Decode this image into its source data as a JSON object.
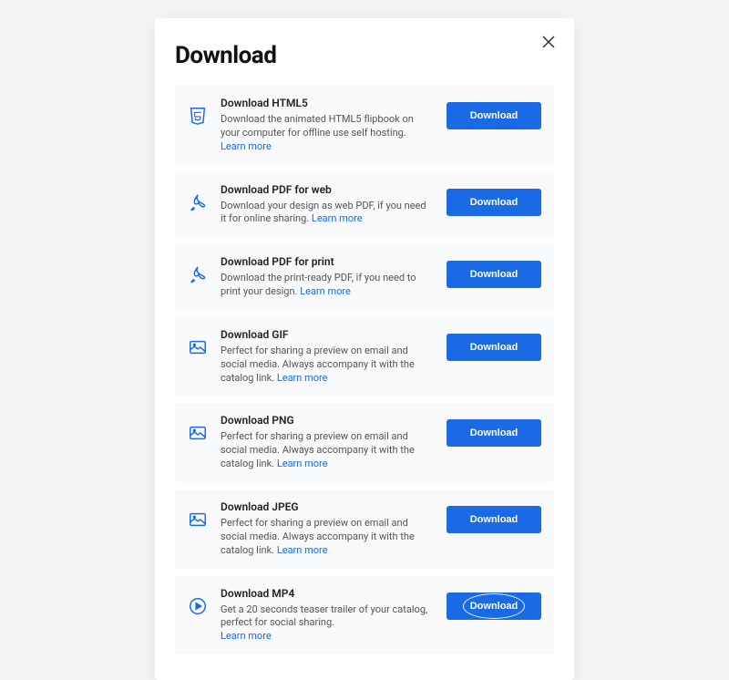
{
  "modal": {
    "title": "Download",
    "learn_more_label": "Learn more",
    "download_button_label": "Download"
  },
  "items": [
    {
      "icon": "html5-icon",
      "title": "Download HTML5",
      "desc": "Download the animated HTML5 flipbook on your computer for offline use self hosting.",
      "learn_more_inline": false,
      "highlighted": false
    },
    {
      "icon": "pdf-icon",
      "title": "Download PDF for web",
      "desc": "Download your design as web PDF, if you need it for online sharing.",
      "learn_more_inline": true,
      "highlighted": false
    },
    {
      "icon": "pdf-icon",
      "title": "Download PDF for print",
      "desc": "Download the print-ready PDF, if you need to print your design.",
      "learn_more_inline": true,
      "highlighted": false
    },
    {
      "icon": "image-icon",
      "title": "Download GIF",
      "desc": "Perfect for sharing a preview on email and social media. Always accompany it with the catalog link.",
      "learn_more_inline": true,
      "highlighted": false
    },
    {
      "icon": "image-icon",
      "title": "Download PNG",
      "desc": "Perfect for sharing a preview on email and social media. Always accompany it with the catalog link.",
      "learn_more_inline": true,
      "highlighted": false
    },
    {
      "icon": "image-icon",
      "title": "Download JPEG",
      "desc": "Perfect for sharing a preview on email and social media. Always accompany it with the catalog link.",
      "learn_more_inline": true,
      "highlighted": false
    },
    {
      "icon": "play-icon",
      "title": "Download MP4",
      "desc": "Get a 20 seconds teaser trailer of your catalog, perfect for social sharing.",
      "learn_more_inline": false,
      "highlighted": true
    }
  ]
}
